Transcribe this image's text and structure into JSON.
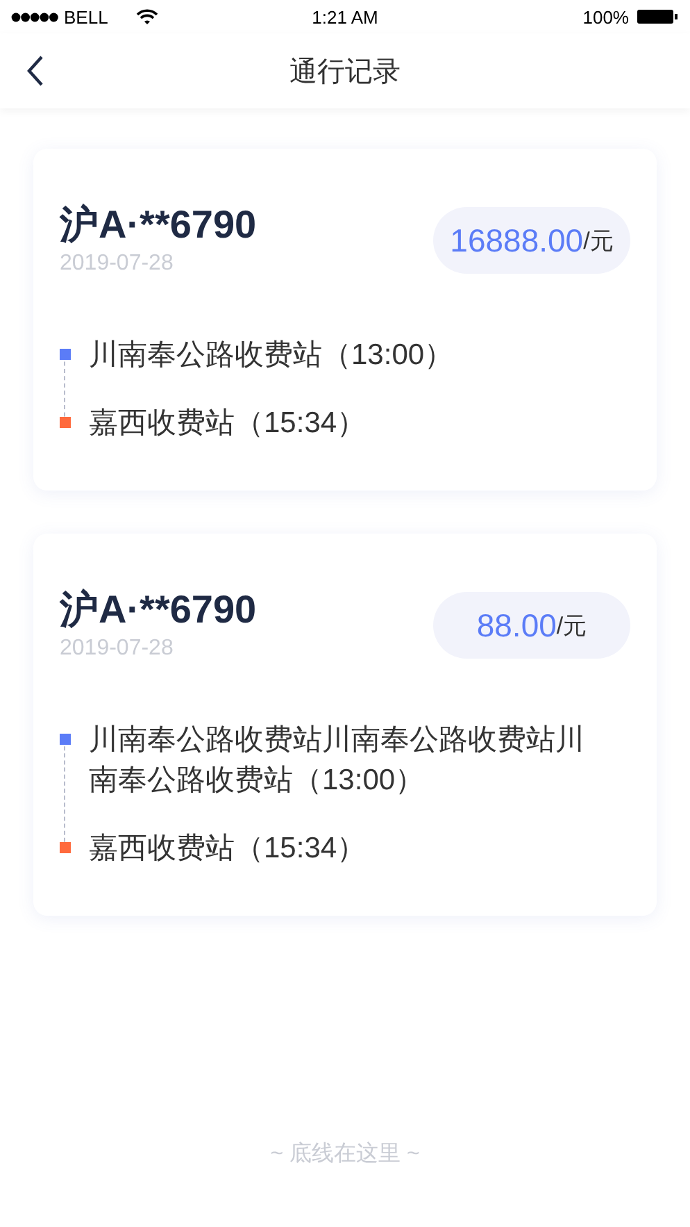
{
  "status_bar": {
    "carrier": "BELL",
    "time": "1:21 AM",
    "battery": "100%"
  },
  "nav": {
    "title": "通行记录"
  },
  "records": [
    {
      "plate": "沪A·**6790",
      "date": "2019-07-28",
      "amount": "16888.00",
      "unit": "/元",
      "stops": [
        {
          "name": "川南奉公路收费站（13:00）",
          "color": "#5b7cf7"
        },
        {
          "name": "嘉西收费站（15:34）",
          "color": "#ff6a3d"
        }
      ]
    },
    {
      "plate": "沪A·**6790",
      "date": "2019-07-28",
      "amount": "88.00",
      "unit": "/元",
      "stops": [
        {
          "name": "川南奉公路收费站川南奉公路收费站川南奉公路收费站（13:00）",
          "color": "#5b7cf7"
        },
        {
          "name": "嘉西收费站（15:34）",
          "color": "#ff6a3d"
        }
      ]
    }
  ],
  "footer": "~ 底线在这里 ~"
}
